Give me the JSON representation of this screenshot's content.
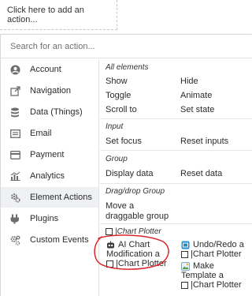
{
  "trigger": {
    "label": "Click here to add an action..."
  },
  "search": {
    "placeholder": "Search for an action..."
  },
  "sidebar": {
    "items": [
      {
        "label": "Account",
        "icon": "account-icon"
      },
      {
        "label": "Navigation",
        "icon": "navigation-icon"
      },
      {
        "label": "Data (Things)",
        "icon": "database-icon"
      },
      {
        "label": "Email",
        "icon": "email-icon"
      },
      {
        "label": "Payment",
        "icon": "payment-icon"
      },
      {
        "label": "Analytics",
        "icon": "analytics-icon"
      },
      {
        "label": "Element Actions",
        "icon": "element-actions-icon",
        "active": true
      },
      {
        "label": "Plugins",
        "icon": "plugins-icon"
      },
      {
        "label": "Custom Events",
        "icon": "custom-events-icon"
      }
    ]
  },
  "content": {
    "all_elements": {
      "heading": "All elements",
      "actions": [
        "Show",
        "Hide",
        "Toggle",
        "Animate",
        "Scroll to",
        "Set state"
      ]
    },
    "input": {
      "heading": "Input",
      "actions": [
        "Set focus",
        "Reset inputs"
      ]
    },
    "group": {
      "heading": "Group",
      "actions": [
        "Display data",
        "Reset data"
      ]
    },
    "dragdrop": {
      "heading": "Drag/drop Group",
      "actions": [
        "Move a",
        "draggable group"
      ]
    },
    "chart_plotter": {
      "heading": "|Chart Plotter",
      "items": [
        {
          "lines": [
            "AI Chart",
            "Modification a",
            "|Chart Plotter"
          ]
        },
        {
          "lines": [
            "Undo/Redo a",
            "|Chart Plotter"
          ]
        },
        {
          "lines": [
            "Make",
            "Template a",
            "|Chart Plotter"
          ]
        }
      ]
    }
  },
  "colors": {
    "annotation_circle": "#d9262b",
    "active_bg": "#eef0f3",
    "plugin_icon_blue": "#1a8fd6"
  }
}
